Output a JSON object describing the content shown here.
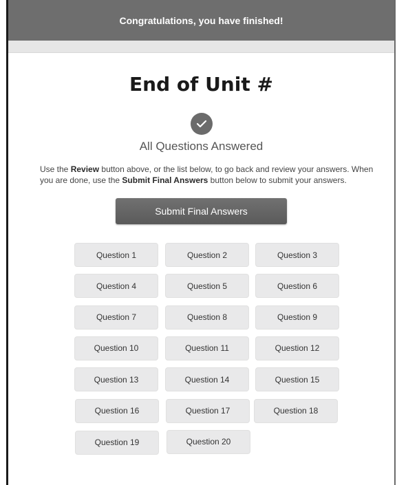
{
  "banner": {
    "text": "Congratulations, you have finished!"
  },
  "page": {
    "title": "End of Unit #"
  },
  "status": {
    "text": "All Questions Answered",
    "icon": "check-icon"
  },
  "instructions": {
    "part1": "Use the ",
    "review_label": "Review",
    "part2": " button above, or the list below, to go back and review your answers. When you are done, use the ",
    "submit_ref_label": "Submit Final Answers",
    "part3": " button below to submit your answers."
  },
  "submit": {
    "label": "Submit Final Answers"
  },
  "questions": [
    "Question 1",
    "Question 2",
    "Question 3",
    "Question 4",
    "Question 5",
    "Question 6",
    "Question 7",
    "Question 8",
    "Question 9",
    "Question 10",
    "Question 11",
    "Question 12",
    "Question 13",
    "Question 14",
    "Question 15",
    "Question 16",
    "Question 17",
    "Question 18",
    "Question 19",
    "Question 20"
  ],
  "colors": {
    "banner": "#6e6e6e",
    "button": "#646464",
    "question_bg": "#e9e9ea"
  }
}
